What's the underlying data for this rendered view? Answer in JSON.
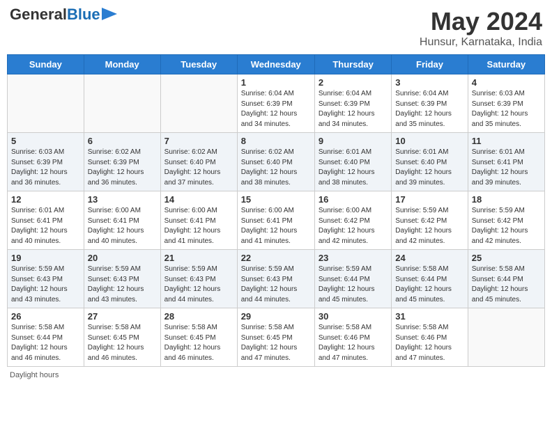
{
  "header": {
    "logo_general": "General",
    "logo_blue": "Blue",
    "month_title": "May 2024",
    "location": "Hunsur, Karnataka, India"
  },
  "days_of_week": [
    "Sunday",
    "Monday",
    "Tuesday",
    "Wednesday",
    "Thursday",
    "Friday",
    "Saturday"
  ],
  "weeks": [
    [
      {
        "num": "",
        "info": ""
      },
      {
        "num": "",
        "info": ""
      },
      {
        "num": "",
        "info": ""
      },
      {
        "num": "1",
        "info": "Sunrise: 6:04 AM\nSunset: 6:39 PM\nDaylight: 12 hours\nand 34 minutes."
      },
      {
        "num": "2",
        "info": "Sunrise: 6:04 AM\nSunset: 6:39 PM\nDaylight: 12 hours\nand 34 minutes."
      },
      {
        "num": "3",
        "info": "Sunrise: 6:04 AM\nSunset: 6:39 PM\nDaylight: 12 hours\nand 35 minutes."
      },
      {
        "num": "4",
        "info": "Sunrise: 6:03 AM\nSunset: 6:39 PM\nDaylight: 12 hours\nand 35 minutes."
      }
    ],
    [
      {
        "num": "5",
        "info": "Sunrise: 6:03 AM\nSunset: 6:39 PM\nDaylight: 12 hours\nand 36 minutes."
      },
      {
        "num": "6",
        "info": "Sunrise: 6:02 AM\nSunset: 6:39 PM\nDaylight: 12 hours\nand 36 minutes."
      },
      {
        "num": "7",
        "info": "Sunrise: 6:02 AM\nSunset: 6:40 PM\nDaylight: 12 hours\nand 37 minutes."
      },
      {
        "num": "8",
        "info": "Sunrise: 6:02 AM\nSunset: 6:40 PM\nDaylight: 12 hours\nand 38 minutes."
      },
      {
        "num": "9",
        "info": "Sunrise: 6:01 AM\nSunset: 6:40 PM\nDaylight: 12 hours\nand 38 minutes."
      },
      {
        "num": "10",
        "info": "Sunrise: 6:01 AM\nSunset: 6:40 PM\nDaylight: 12 hours\nand 39 minutes."
      },
      {
        "num": "11",
        "info": "Sunrise: 6:01 AM\nSunset: 6:41 PM\nDaylight: 12 hours\nand 39 minutes."
      }
    ],
    [
      {
        "num": "12",
        "info": "Sunrise: 6:01 AM\nSunset: 6:41 PM\nDaylight: 12 hours\nand 40 minutes."
      },
      {
        "num": "13",
        "info": "Sunrise: 6:00 AM\nSunset: 6:41 PM\nDaylight: 12 hours\nand 40 minutes."
      },
      {
        "num": "14",
        "info": "Sunrise: 6:00 AM\nSunset: 6:41 PM\nDaylight: 12 hours\nand 41 minutes."
      },
      {
        "num": "15",
        "info": "Sunrise: 6:00 AM\nSunset: 6:41 PM\nDaylight: 12 hours\nand 41 minutes."
      },
      {
        "num": "16",
        "info": "Sunrise: 6:00 AM\nSunset: 6:42 PM\nDaylight: 12 hours\nand 42 minutes."
      },
      {
        "num": "17",
        "info": "Sunrise: 5:59 AM\nSunset: 6:42 PM\nDaylight: 12 hours\nand 42 minutes."
      },
      {
        "num": "18",
        "info": "Sunrise: 5:59 AM\nSunset: 6:42 PM\nDaylight: 12 hours\nand 42 minutes."
      }
    ],
    [
      {
        "num": "19",
        "info": "Sunrise: 5:59 AM\nSunset: 6:43 PM\nDaylight: 12 hours\nand 43 minutes."
      },
      {
        "num": "20",
        "info": "Sunrise: 5:59 AM\nSunset: 6:43 PM\nDaylight: 12 hours\nand 43 minutes."
      },
      {
        "num": "21",
        "info": "Sunrise: 5:59 AM\nSunset: 6:43 PM\nDaylight: 12 hours\nand 44 minutes."
      },
      {
        "num": "22",
        "info": "Sunrise: 5:59 AM\nSunset: 6:43 PM\nDaylight: 12 hours\nand 44 minutes."
      },
      {
        "num": "23",
        "info": "Sunrise: 5:59 AM\nSunset: 6:44 PM\nDaylight: 12 hours\nand 45 minutes."
      },
      {
        "num": "24",
        "info": "Sunrise: 5:58 AM\nSunset: 6:44 PM\nDaylight: 12 hours\nand 45 minutes."
      },
      {
        "num": "25",
        "info": "Sunrise: 5:58 AM\nSunset: 6:44 PM\nDaylight: 12 hours\nand 45 minutes."
      }
    ],
    [
      {
        "num": "26",
        "info": "Sunrise: 5:58 AM\nSunset: 6:44 PM\nDaylight: 12 hours\nand 46 minutes."
      },
      {
        "num": "27",
        "info": "Sunrise: 5:58 AM\nSunset: 6:45 PM\nDaylight: 12 hours\nand 46 minutes."
      },
      {
        "num": "28",
        "info": "Sunrise: 5:58 AM\nSunset: 6:45 PM\nDaylight: 12 hours\nand 46 minutes."
      },
      {
        "num": "29",
        "info": "Sunrise: 5:58 AM\nSunset: 6:45 PM\nDaylight: 12 hours\nand 47 minutes."
      },
      {
        "num": "30",
        "info": "Sunrise: 5:58 AM\nSunset: 6:46 PM\nDaylight: 12 hours\nand 47 minutes."
      },
      {
        "num": "31",
        "info": "Sunrise: 5:58 AM\nSunset: 6:46 PM\nDaylight: 12 hours\nand 47 minutes."
      },
      {
        "num": "",
        "info": ""
      }
    ]
  ],
  "footer": {
    "daylight_label": "Daylight hours"
  }
}
